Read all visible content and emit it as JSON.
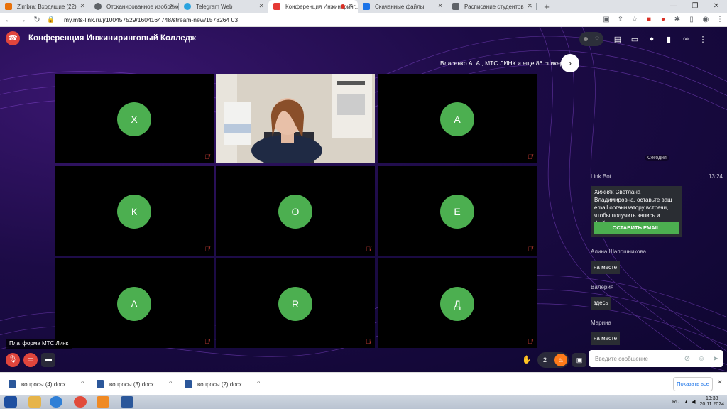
{
  "browser": {
    "tabs": [
      {
        "title": "Zimbra: Входящие (22)",
        "color": "#e8710a"
      },
      {
        "title": "Отсканированное изображен...",
        "color": "#5f6368"
      },
      {
        "title": "Telegram Web",
        "color": "#2aa3df"
      },
      {
        "title": "Конференция Инжиниринг...",
        "color": "#e53935"
      },
      {
        "title": "Скачанные файлы",
        "color": "#1a73e8"
      },
      {
        "title": "Расписание студентов",
        "color": "#5f6368"
      }
    ],
    "url": "my.mts-link.ru/j/100457529/1604164748/stream-new/1578264 03"
  },
  "conference": {
    "title": "Конференция Инжиниринговый Колледж",
    "speakers_line": "Власенко А. А., МТС ЛИНК и еще 86 спикеров",
    "tiles": [
      {
        "letter": "Х"
      },
      {
        "letter": ""
      },
      {
        "letter": "А"
      },
      {
        "letter": "К"
      },
      {
        "letter": "О"
      },
      {
        "letter": "Е"
      },
      {
        "letter": "А"
      },
      {
        "letter": "R"
      },
      {
        "letter": "Д"
      }
    ],
    "platform_label": "Платформа МТС Линк",
    "reactions_count": "2"
  },
  "chat": {
    "today": "Сегодня",
    "bot_name": "Link Bot",
    "bot_time": "13:24",
    "bot_message": "Хижняк Светлана Владимировна, оставьте ваш email организатору встречи, чтобы получить запись и файлы",
    "bot_button": "ОСТАВИТЬ EMAIL",
    "messages": [
      {
        "sender": "Алина Шапошникова",
        "text": "на месте"
      },
      {
        "sender": "Валерия",
        "text": "здесь"
      },
      {
        "sender": "Марина",
        "text": "на месте"
      }
    ],
    "input_placeholder": "Введите сообщение"
  },
  "downloads": {
    "items": [
      {
        "name": "вопросы (4).docx"
      },
      {
        "name": "вопросы (3).docx"
      },
      {
        "name": "вопросы (2).docx"
      }
    ],
    "show_all": "Показать все"
  },
  "taskbar": {
    "lang": "RU",
    "time": "13:38",
    "date": "20.11.2024"
  },
  "colors": {
    "accent_green": "#4caf50",
    "danger_red": "#e0453c",
    "background": "#1c0b46"
  }
}
